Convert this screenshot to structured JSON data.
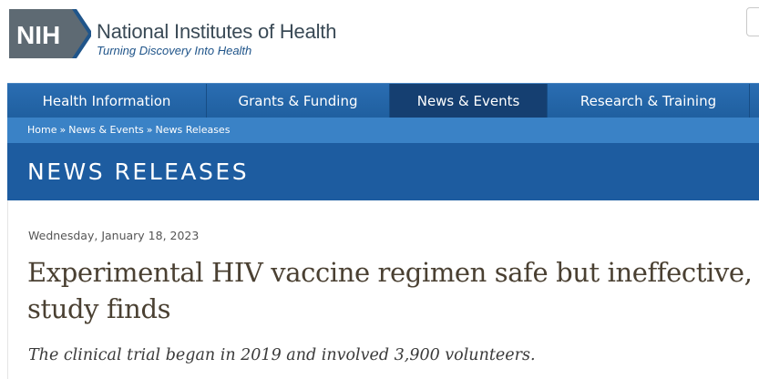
{
  "header": {
    "logo_abbrev": "NIH",
    "logo_title": "National Institutes of Health",
    "logo_tagline": "Turning Discovery Into Health"
  },
  "nav": {
    "items": [
      {
        "label": "Health Information"
      },
      {
        "label": "Grants & Funding"
      },
      {
        "label": "News & Events"
      },
      {
        "label": "Research & Training"
      },
      {
        "label": ""
      }
    ],
    "active": "News & Events"
  },
  "breadcrumb": {
    "items": [
      "Home",
      "News & Events",
      "News Releases"
    ],
    "separator": "»"
  },
  "section": {
    "title": "NEWS RELEASES"
  },
  "article": {
    "date": "Wednesday, January 18, 2023",
    "headline": "Experimental HIV vaccine regimen safe but ineffective, study finds",
    "subhead": "The clinical trial began in 2019 and involved 3,900 volunteers."
  },
  "colors": {
    "nav_bg": "#2a6db2",
    "nav_active": "#153f71",
    "crumb_bar": "#3a82c6",
    "section_banner": "#1d5ca0",
    "headline_text": "#4a4032",
    "logo_gray": "#5a6670",
    "logo_blue": "#20558a"
  }
}
